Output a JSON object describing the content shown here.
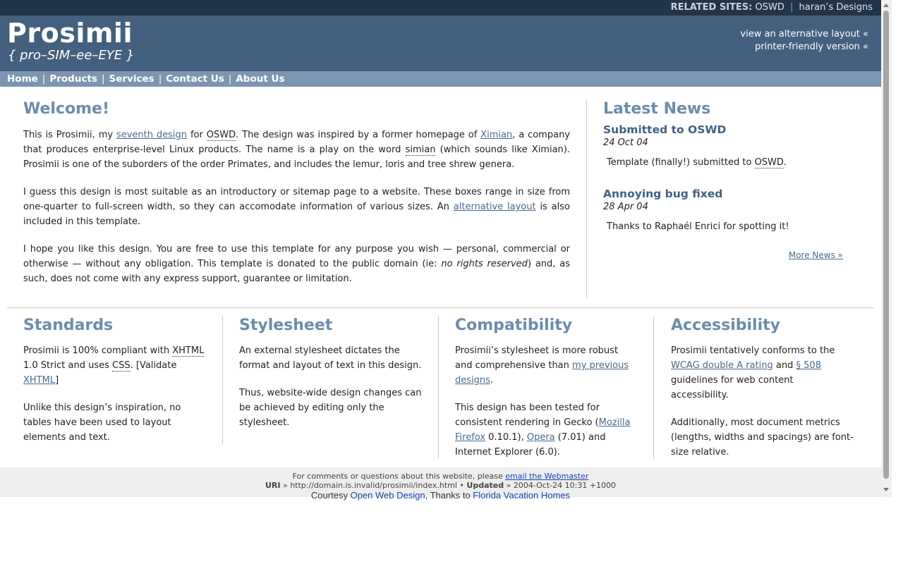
{
  "superheader": {
    "label": "RELATED SITES:",
    "links": [
      "OSWD",
      "haran’s Designs"
    ],
    "separator": "|"
  },
  "header": {
    "title": "Prosimii",
    "tagline": "{ pro–SIM–ee–EYE }",
    "alt_layout": "view an alternative layout «",
    "printer": "printer-friendly version «"
  },
  "nav": {
    "items": [
      "Home",
      "Products",
      "Services",
      "Contact Us",
      "About Us"
    ],
    "separator": "|"
  },
  "main": {
    "heading": "Welcome!",
    "p1": {
      "a": "This is Prosimii, my ",
      "link1": "seventh design",
      "b": " for ",
      "abbr1": "OSWD",
      "c": ". The design was inspired by a former homepage of ",
      "link2": "Ximian",
      "d": ", a company that produces enterprise-level Linux products. The name is a play on the word ",
      "abbr2": "simian",
      "e": " (which sounds like Ximian). Prosimii is one of the suborders of the order Primates, and includes the lemur, loris and tree shrew genera."
    },
    "p2": {
      "a": "I guess this design is most suitable as an introductory or sitemap page to a website. These boxes range in size from one-quarter to full-screen width, so they can accomodate information of various sizes. An ",
      "link": "alternative layout",
      "b": " is also included in this template."
    },
    "p3": {
      "a": "I hope you like this design. You are free to use this template for any purpose you wish — personal, commercial or otherwise — without any obligation. This template is donated to the public domain (ie: ",
      "em": "no rights reserved",
      "b": ") and, as such, does not come with any express support, guarantee or limitation."
    }
  },
  "news": {
    "heading": "Latest News",
    "items": [
      {
        "title": "Submitted to OSWD",
        "date": "24 Oct 04",
        "body_a": "Template (finally!) submitted to ",
        "abbr": "OSWD",
        "body_b": "."
      },
      {
        "title": "Annoying bug fixed",
        "date": "28 Apr 04",
        "body_a": "Thanks to Raphaél Enrici for spotting it!",
        "abbr": "",
        "body_b": ""
      }
    ],
    "more": "More News »"
  },
  "columns": {
    "standards": {
      "heading": "Standards",
      "p1a": "Prosimii is 100% compliant with ",
      "p1abbr1": "XHTML",
      "p1b": " 1.0 Strict and uses ",
      "p1abbr2": "CSS",
      "p1c": ". [Validate ",
      "p1link": "XHTML",
      "p1d": "]",
      "p2": "Unlike this design’s inspiration, no tables have been used to layout elements and text."
    },
    "stylesheet": {
      "heading": "Stylesheet",
      "p1": "An external stylesheet dictates the format and layout of text in this design.",
      "p2": "Thus, website-wide design changes can be achieved by editing only the stylesheet."
    },
    "compatibility": {
      "heading": "Compatibility",
      "p1a": "Prosimii’s stylesheet is more robust and comprehensive than ",
      "p1link": "my previous designs",
      "p1b": ".",
      "p2a": "This design has been tested for consistent rendering in Gecko (",
      "link_mozilla": "Mozilla",
      "link_firefox": "Firefox",
      "p2b": " 0.10.1), ",
      "link_opera": "Opera",
      "p2c": " (7.01) and Internet Explorer (6.0)."
    },
    "accessibility": {
      "heading": "Accessibility",
      "p1a": "Prosimii tentatively conforms to the ",
      "link_wcag": "WCAG double A rating",
      "p1b": " and ",
      "link_508": "§ 508",
      "p1c": " guidelines for web content accessibility.",
      "p2": "Additionally, most document metrics (lengths, widths and spacings) are font-size relative."
    }
  },
  "footer": {
    "line1": "For comments or questions about this website, please ",
    "line1_link": "email the Webmaster",
    "uri_label": "URI",
    "arrow": "»",
    "uri": "http://domain.is.invalid/prosimii/index.html",
    "bullet": "•",
    "updated_label": "Updated",
    "updated": "2004-Oct-24 10:31 +1000",
    "courtesy": "Courtesy",
    "courtesy_link": "Open Web Design",
    "thanks": "Thanks to",
    "thanks_link": "Florida Vacation Homes"
  }
}
